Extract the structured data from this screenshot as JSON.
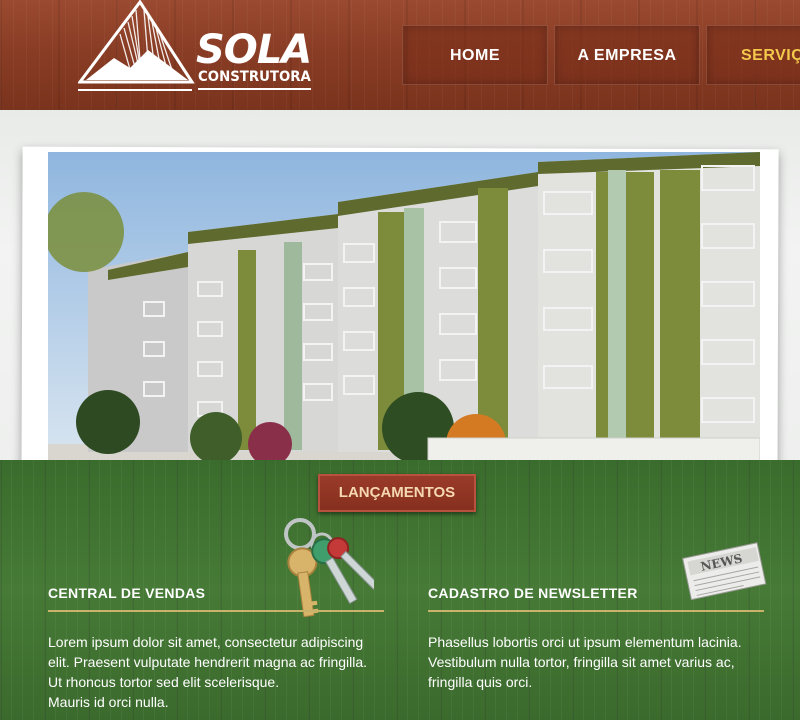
{
  "logo": {
    "title": "SOLA",
    "subtitle": "CONSTRUTORA"
  },
  "nav": {
    "items": [
      "HOME",
      "A EMPRESA",
      "SERVIÇO"
    ]
  },
  "launch_button": "LANÇAMENTOS",
  "colors": {
    "header_wood": "#8a3d25",
    "footer_wood": "#3f6f30",
    "accent_gold": "#f2c94c",
    "rule_gold": "#c9b36a"
  },
  "sections": {
    "sales": {
      "title": "CENTRAL DE VENDAS",
      "lines": [
        "Lorem ipsum dolor sit amet, consectetur adipiscing",
        "elit. Praesent vulputate hendrerit magna ac fringilla.",
        "Ut rhoncus tortor sed elit scelerisque.",
        "Mauris id orci nulla."
      ]
    },
    "newsletter": {
      "title": "CADASTRO DE NEWSLETTER",
      "lines": [
        "Phasellus lobortis orci ut ipsum elementum lacinia.",
        "Vestibulum nulla tortor, fringilla sit amet varius ac,",
        "fringilla quis orci."
      ]
    }
  },
  "icons": {
    "logo": "mountain-logo-icon",
    "keys": "keys-icon",
    "newspaper": "newspaper-icon"
  },
  "newspaper_label": "NEWS"
}
